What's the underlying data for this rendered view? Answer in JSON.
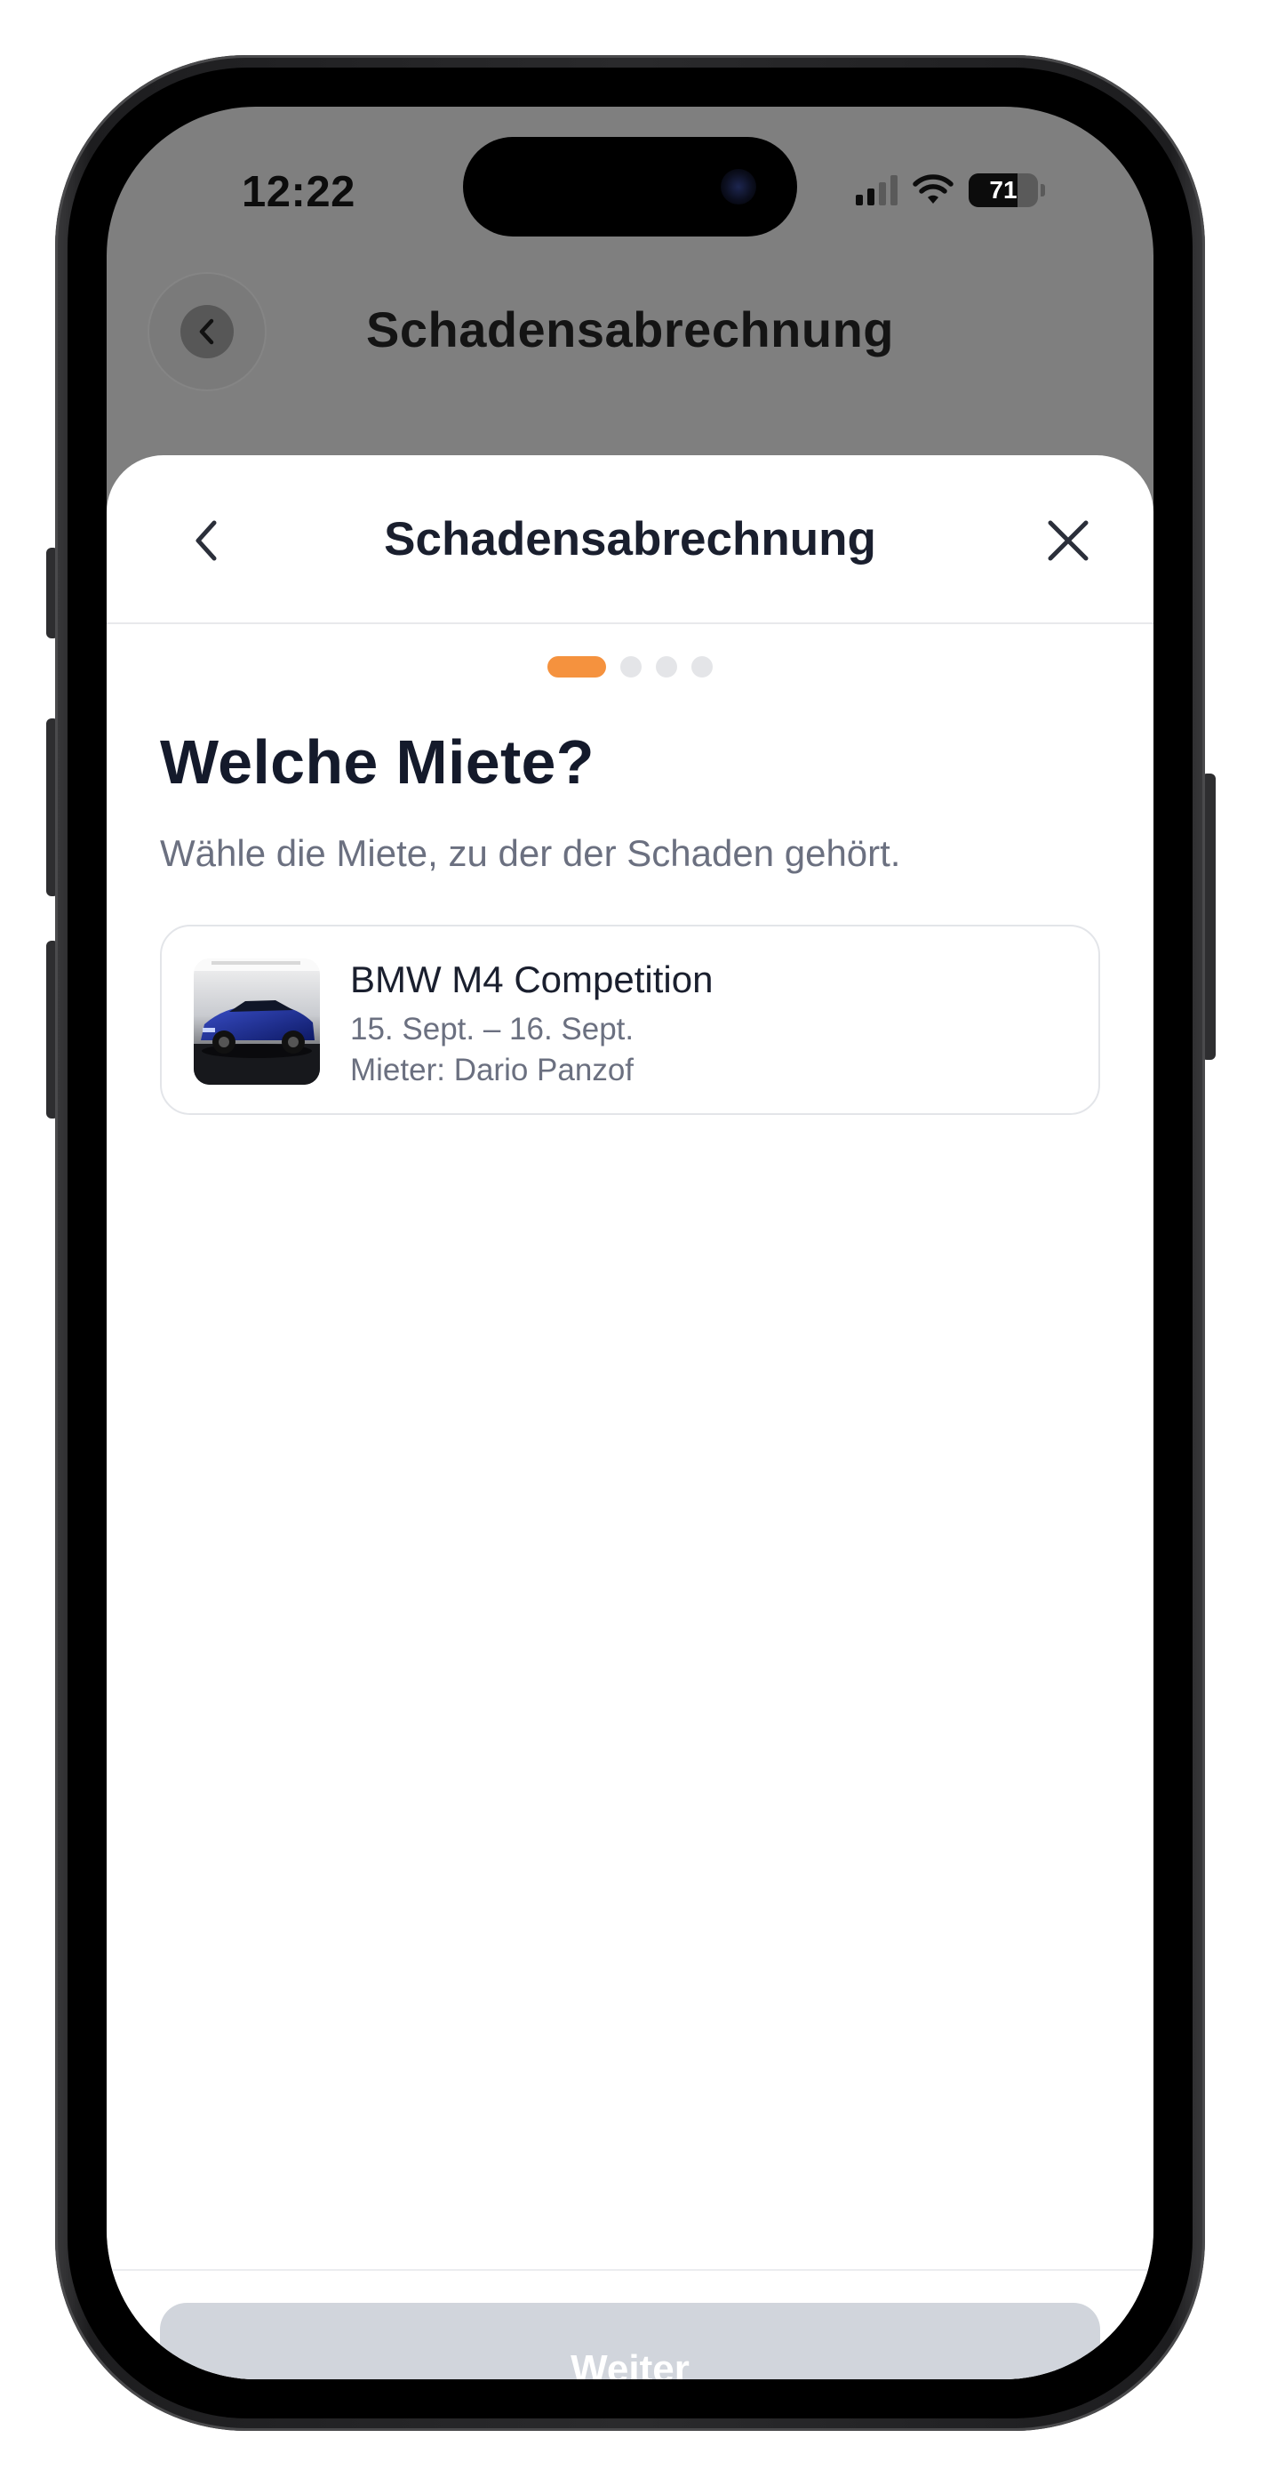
{
  "status_bar": {
    "time": "12:22",
    "battery": "71",
    "battery_level": 0.71
  },
  "background_page": {
    "title": "Schadensabrechnung"
  },
  "sheet": {
    "title": "Schadensabrechnung",
    "steps_total": 4,
    "current_step": 1,
    "question": "Welche Miete?",
    "subtitle": "Wähle die Miete, zu der der Schaden gehört.",
    "rental": {
      "name": "BMW M4 Competition",
      "dates": "15. Sept. – 16. Sept.",
      "renter": "Mieter: Dario Panzof"
    },
    "next_label": "Weiter"
  },
  "colors": {
    "accent": "#f5923e",
    "button_disabled": "#d1d5dc",
    "overlay": "#7f7f7f"
  },
  "icons": {
    "back": "chevron-left-icon",
    "close": "close-icon",
    "signal": "cellular-signal-icon",
    "wifi": "wifi-icon",
    "battery": "battery-icon"
  }
}
